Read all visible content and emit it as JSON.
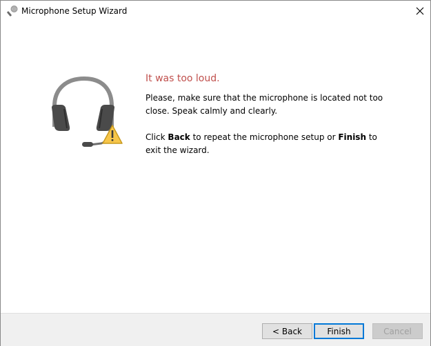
{
  "window": {
    "title": "Microphone Setup Wizard",
    "app_icon": "microphone-icon",
    "close_icon": "close-icon"
  },
  "main": {
    "illustration_icon": "headset-warning-icon",
    "heading": "It was too loud.",
    "message": "Please, make sure that the microphone is located not too close. Speak calmly and clearly.",
    "instruction": {
      "before_back": "Click ",
      "back_word": "Back",
      "middle": " to repeat the microphone setup or ",
      "finish_word": "Finish",
      "after_finish": " to exit the wizard."
    }
  },
  "footer": {
    "back_label": "< Back",
    "finish_label": "Finish",
    "cancel_label": "Cancel"
  },
  "colors": {
    "heading": "#c0504d",
    "warning": "#f7c64a",
    "focus_border": "#0078d7"
  }
}
